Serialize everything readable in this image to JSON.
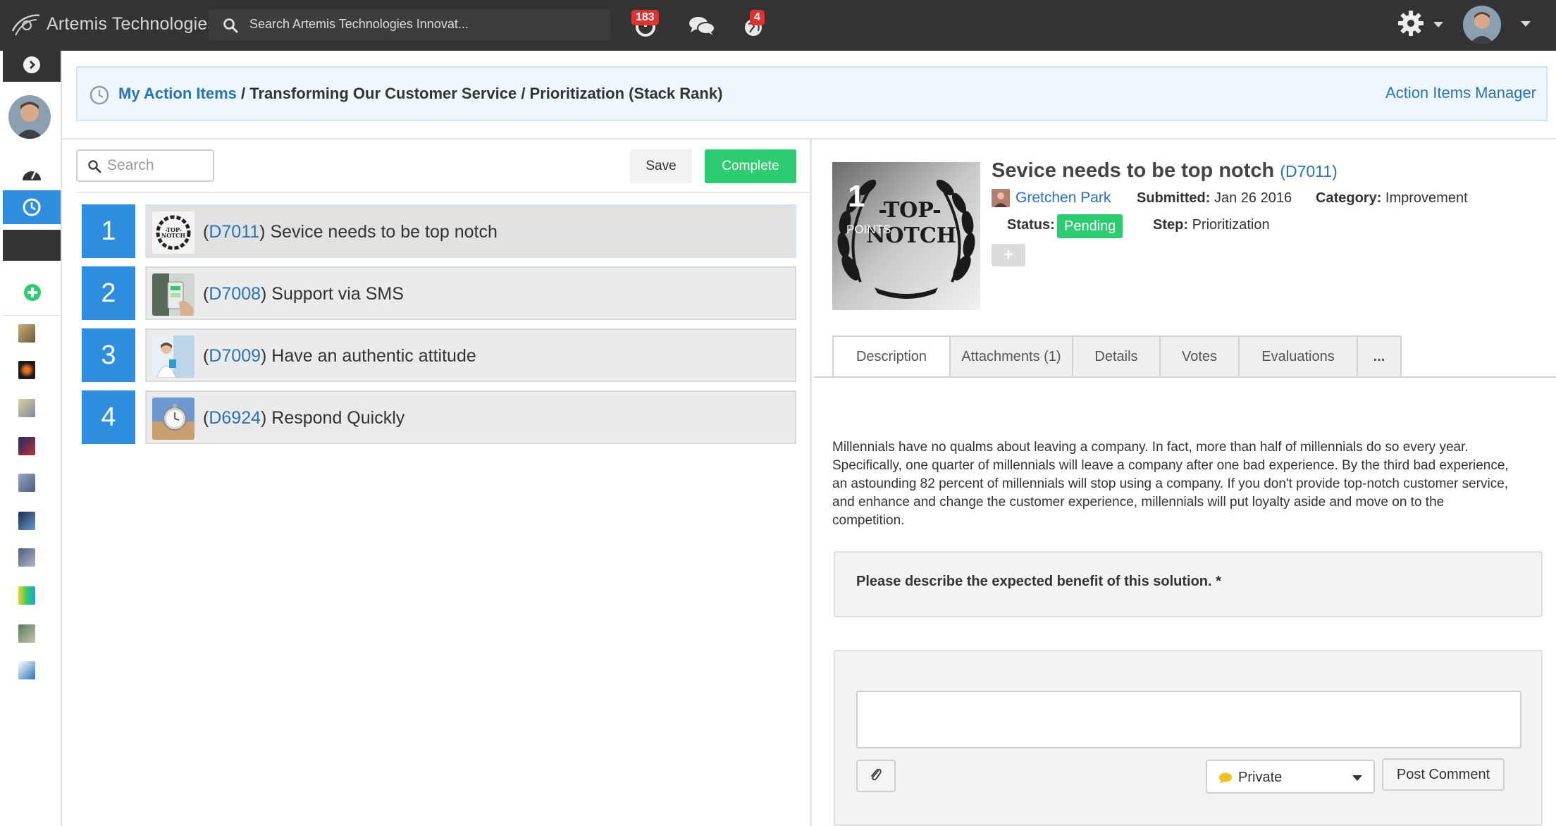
{
  "app": {
    "brand_name": "Artemis Technologies",
    "search_placeholder": "Search Artemis Technologies Innovat...",
    "notifications_badge": "183",
    "alerts_badge": "4",
    "icons": [
      "refresh-notifications-icon",
      "chat-icon",
      "globe-alerts-icon",
      "gear-icon",
      "user-menu-caret-icon"
    ]
  },
  "breadcrumb": {
    "link": "My Action Items",
    "rest": " / Transforming Our Customer Service / Prioritization (Stack Rank)",
    "manager_link": "Action Items Manager"
  },
  "ranking": {
    "search_placeholder": "Search",
    "save_label": "Save",
    "complete_label": "Complete",
    "items": [
      {
        "rank": "1",
        "code": "D7011",
        "title": "Sevice needs to be top notch"
      },
      {
        "rank": "2",
        "code": "D7008",
        "title": "Support via SMS"
      },
      {
        "rank": "3",
        "code": "D7009",
        "title": "Have an authentic attitude"
      },
      {
        "rank": "4",
        "code": "D6924",
        "title": "Respond Quickly"
      }
    ]
  },
  "idea": {
    "points": "1",
    "points_label": "POINTS",
    "title": "Sevice needs to be top notch",
    "code": "D7011",
    "author": "Gretchen Park",
    "submitted_label": "Submitted:",
    "submitted": "Jan 26 2016",
    "category_label": "Category:",
    "category": "Improvement",
    "status_label": "Status:",
    "status": "Pending",
    "step_label": "Step:",
    "step": "Prioritization",
    "image_text_top": "-TOP-",
    "image_text_bottom": "NOTCH",
    "plus_label": "+"
  },
  "tabs": [
    {
      "label": "Description"
    },
    {
      "label": "Attachments (1)"
    },
    {
      "label": "Details"
    },
    {
      "label": "Votes"
    },
    {
      "label": "Evaluations"
    },
    {
      "label": "..."
    }
  ],
  "description": "Millennials have no qualms about leaving a company. In fact, more than half of millennials do so every year. Specifically, one quarter of millennials will leave a company after one bad experience. By the third bad experience, an astounding 82 percent of millennials will stop using a company. If you don't provide top-notch customer service, and enhance and change the customer experience, millennials will put loyalty aside and move on to the competition.",
  "question": "Please describe the expected benefit of this solution. *",
  "comment": {
    "visibility": "Private",
    "post_label": "Post Comment"
  },
  "colors": {
    "topbar": "#333333",
    "accent_blue": "#2f8de0",
    "link_blue": "#2a73b8",
    "success_green": "#2ecc71",
    "badge_red": "#e03131"
  }
}
